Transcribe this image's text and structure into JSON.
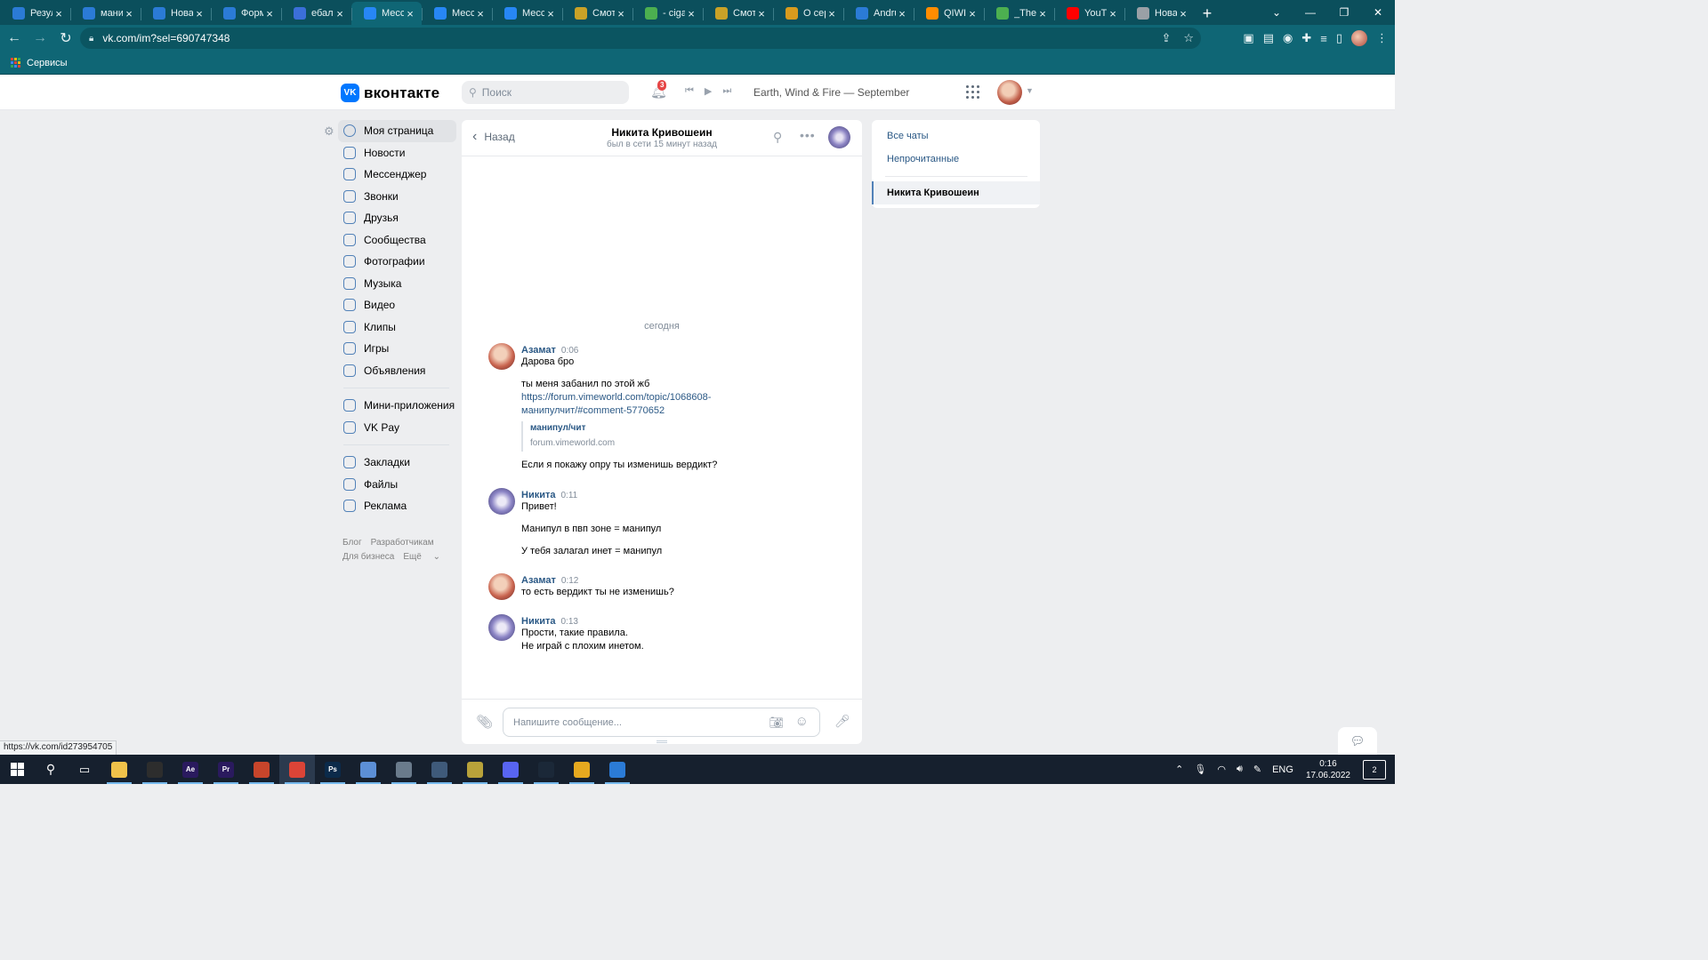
{
  "browser": {
    "tabs": [
      {
        "label": "Резул",
        "icon": "vimeworld-icon",
        "color": "#2b7bd6"
      },
      {
        "label": "мани",
        "icon": "vimeworld-icon",
        "color": "#2b7bd6"
      },
      {
        "label": "Нова",
        "icon": "vimeworld-icon",
        "color": "#2b7bd6"
      },
      {
        "label": "Форм",
        "icon": "vimeworld-icon",
        "color": "#2b7bd6"
      },
      {
        "label": "ебал",
        "icon": "feather-icon",
        "color": "#3b6fd8"
      },
      {
        "label": "Месс",
        "icon": "chat-icon",
        "color": "#2787f5",
        "active": true
      },
      {
        "label": "Месс",
        "icon": "chat-icon",
        "color": "#2787f5"
      },
      {
        "label": "Месс",
        "icon": "chat-icon",
        "color": "#2787f5"
      },
      {
        "label": "Смотр",
        "icon": "clover-icon",
        "color": "#c9a227"
      },
      {
        "label": "- ciga",
        "icon": "game-icon",
        "color": "#4caf50"
      },
      {
        "label": "Смотр",
        "icon": "clover-icon",
        "color": "#c9a227"
      },
      {
        "label": "О сер",
        "icon": "coin-icon",
        "color": "#d89b1e"
      },
      {
        "label": "Andru",
        "icon": "vimeworld-icon",
        "color": "#2b7bd6"
      },
      {
        "label": "QIWI",
        "icon": "qiwi-icon",
        "color": "#ff8c00"
      },
      {
        "label": "_TheS",
        "icon": "game-icon",
        "color": "#4caf50"
      },
      {
        "label": "YouTu",
        "icon": "youtube-icon",
        "color": "#ff0000"
      },
      {
        "label": "Нова",
        "icon": "chrome-icon",
        "color": "#9aa0a6"
      }
    ],
    "url": "vk.com/im?sel=690747348",
    "bookmarks_label": "Сервисы",
    "status_url": "https://vk.com/id273954705"
  },
  "header": {
    "logo_text": "вконтакте",
    "logo_mark": "VK",
    "search_placeholder": "Поиск",
    "notifications_count": "3",
    "now_playing": "Earth, Wind & Fire — September"
  },
  "menu": {
    "items": [
      {
        "label": "Моя страница",
        "icon": "profile-icon"
      },
      {
        "label": "Новости",
        "icon": "news-icon"
      },
      {
        "label": "Мессенджер",
        "icon": "messenger-icon"
      },
      {
        "label": "Звонки",
        "icon": "phone-icon"
      },
      {
        "label": "Друзья",
        "icon": "friends-icon"
      },
      {
        "label": "Сообщества",
        "icon": "communities-icon"
      },
      {
        "label": "Фотографии",
        "icon": "photos-icon"
      },
      {
        "label": "Музыка",
        "icon": "music-icon"
      },
      {
        "label": "Видео",
        "icon": "video-icon"
      },
      {
        "label": "Клипы",
        "icon": "clips-icon"
      },
      {
        "label": "Игры",
        "icon": "games-icon"
      },
      {
        "label": "Объявления",
        "icon": "classifieds-icon"
      }
    ],
    "items2": [
      {
        "label": "Мини-приложения",
        "icon": "miniapps-icon"
      },
      {
        "label": "VK Pay",
        "icon": "vkpay-icon"
      }
    ],
    "items3": [
      {
        "label": "Закладки",
        "icon": "bookmarks-icon"
      },
      {
        "label": "Файлы",
        "icon": "files-icon"
      },
      {
        "label": "Реклама",
        "icon": "ads-icon"
      }
    ],
    "footer": {
      "blog": "Блог",
      "dev": "Разработчикам",
      "biz": "Для бизнеса",
      "more": "Ещё"
    }
  },
  "chat": {
    "back_label": "Назад",
    "peer_name": "Никита Кривошеин",
    "peer_status": "был в сети 15 минут назад",
    "day_label": "сегодня",
    "composer_placeholder": "Напишите сообщение...",
    "messages": [
      {
        "author": "Азамат",
        "time": "0:06",
        "line1": "Дарова бро",
        "line2": "ты меня забанил по этой жб",
        "link1": "https://forum.vimeworld.com/topic/1068608-",
        "link2": "манипулчит/#comment-5770652",
        "snippet_title": "манипул/чит",
        "snippet_domain": "forum.vimeworld.com",
        "line3": "Если я покажу опру ты изменишь вердикт?"
      },
      {
        "author": "Никита",
        "time": "0:11",
        "line1": "Привет!",
        "line2": "Манипул в пвп зоне = манипул",
        "line3": "У тебя залагал инет = манипул"
      },
      {
        "author": "Азамат",
        "time": "0:12",
        "line1": "то есть вердикт ты не изменишь?"
      },
      {
        "author": "Никита",
        "time": "0:13",
        "line1": "Прости, такие правила.",
        "line2": "Не играй с плохим инетом."
      }
    ]
  },
  "chatlist": {
    "all": "Все чаты",
    "unread": "Непрочитанные",
    "selected": "Никита Кривошеин"
  },
  "taskbar": {
    "apps": [
      {
        "name": "file-explorer-icon",
        "glyph": "",
        "color": "#f0c24a"
      },
      {
        "name": "obs-icon",
        "glyph": "",
        "color": "#2d2d2d"
      },
      {
        "name": "after-effects-icon",
        "glyph": "Ae",
        "color": "#2a1a5e"
      },
      {
        "name": "premiere-icon",
        "glyph": "Pr",
        "color": "#2a1a5e"
      },
      {
        "name": "app-icon",
        "glyph": "",
        "color": "#c7452b"
      },
      {
        "name": "chrome-icon",
        "glyph": "",
        "color": "#db4437",
        "active": true
      },
      {
        "name": "photoshop-icon",
        "glyph": "Ps",
        "color": "#0b2a4a"
      },
      {
        "name": "paint-icon",
        "glyph": "",
        "color": "#5c8fd6"
      },
      {
        "name": "app2-icon",
        "glyph": "",
        "color": "#6a7b8c"
      },
      {
        "name": "calculator-icon",
        "glyph": "",
        "color": "#3f5a7a"
      },
      {
        "name": "cheat-engine-icon",
        "glyph": "",
        "color": "#b8a23a"
      },
      {
        "name": "discord-icon",
        "glyph": "",
        "color": "#5865f2"
      },
      {
        "name": "steam-icon",
        "glyph": "",
        "color": "#1b2838"
      },
      {
        "name": "app3-icon",
        "glyph": "",
        "color": "#e6a91f"
      },
      {
        "name": "vimeworld-icon",
        "glyph": "",
        "color": "#2b7bd6"
      }
    ],
    "lang": "ENG",
    "time": "0:16",
    "date": "17.06.2022",
    "notif_count": "2"
  }
}
